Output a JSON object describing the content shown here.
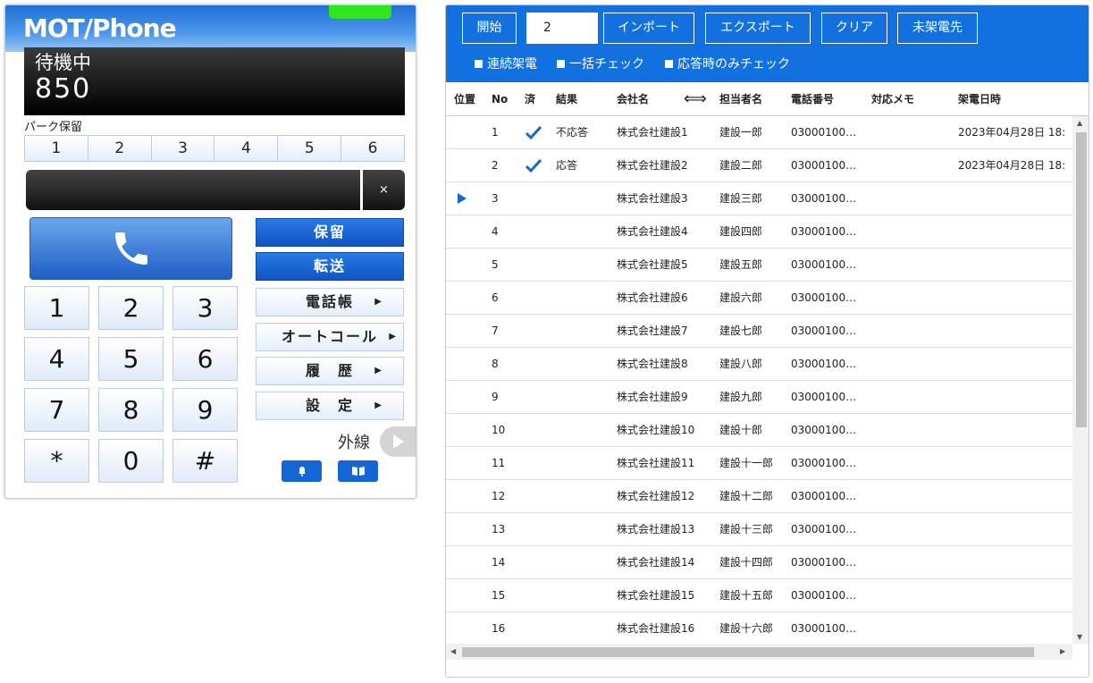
{
  "phone": {
    "logo": "MOT/Phone",
    "display": {
      "state": "待機中",
      "extension": "850"
    },
    "park": {
      "label": "パーク保留",
      "slots": [
        "1",
        "2",
        "3",
        "4",
        "5",
        "6"
      ]
    },
    "clear_label": "×",
    "keys": [
      "1",
      "2",
      "3",
      "4",
      "5",
      "6",
      "7",
      "8",
      "9",
      "*",
      "0",
      "#"
    ],
    "functions": {
      "hold": "保留",
      "transfer": "転送",
      "phonebook": "電話帳",
      "autocall": "オートコール",
      "history": "履　歴",
      "settings": "設　定",
      "arrow": "▶"
    },
    "outside_line": "外線"
  },
  "toolbar": {
    "start": "開始",
    "count_value": "2",
    "import": "インポート",
    "export": "エクスポート",
    "clear": "クリア",
    "uncalled": "未架電先",
    "options": [
      "連続架電",
      "一括チェック",
      "応答時のみチェック"
    ]
  },
  "table": {
    "headers": {
      "position": "位置",
      "no": "No",
      "done": "済",
      "result": "結果",
      "company": "会社名",
      "resize": "⟺",
      "person": "担当者名",
      "phone": "電話番号",
      "memo": "対応メモ",
      "datetime": "架電日時"
    },
    "current_row": 3,
    "rows": [
      {
        "no": "1",
        "done": true,
        "result": "不応答",
        "company": "株式会社建設1",
        "person": "建設一郎",
        "phone": "03000100…",
        "memo": "",
        "datetime": "2023年04月28日 18:"
      },
      {
        "no": "2",
        "done": true,
        "result": "応答",
        "company": "株式会社建設2",
        "person": "建設二郎",
        "phone": "03000100…",
        "memo": "",
        "datetime": "2023年04月28日 18:"
      },
      {
        "no": "3",
        "done": false,
        "result": "",
        "company": "株式会社建設3",
        "person": "建設三郎",
        "phone": "03000100…",
        "memo": "",
        "datetime": ""
      },
      {
        "no": "4",
        "done": false,
        "result": "",
        "company": "株式会社建設4",
        "person": "建設四郎",
        "phone": "03000100…",
        "memo": "",
        "datetime": ""
      },
      {
        "no": "5",
        "done": false,
        "result": "",
        "company": "株式会社建設5",
        "person": "建設五郎",
        "phone": "03000100…",
        "memo": "",
        "datetime": ""
      },
      {
        "no": "6",
        "done": false,
        "result": "",
        "company": "株式会社建設6",
        "person": "建設六郎",
        "phone": "03000100…",
        "memo": "",
        "datetime": ""
      },
      {
        "no": "7",
        "done": false,
        "result": "",
        "company": "株式会社建設7",
        "person": "建設七郎",
        "phone": "03000100…",
        "memo": "",
        "datetime": ""
      },
      {
        "no": "8",
        "done": false,
        "result": "",
        "company": "株式会社建設8",
        "person": "建設八郎",
        "phone": "03000100…",
        "memo": "",
        "datetime": ""
      },
      {
        "no": "9",
        "done": false,
        "result": "",
        "company": "株式会社建設9",
        "person": "建設九郎",
        "phone": "03000100…",
        "memo": "",
        "datetime": ""
      },
      {
        "no": "10",
        "done": false,
        "result": "",
        "company": "株式会社建設10",
        "person": "建設十郎",
        "phone": "03000100…",
        "memo": "",
        "datetime": ""
      },
      {
        "no": "11",
        "done": false,
        "result": "",
        "company": "株式会社建設11",
        "person": "建設十一郎",
        "phone": "03000100…",
        "memo": "",
        "datetime": ""
      },
      {
        "no": "12",
        "done": false,
        "result": "",
        "company": "株式会社建設12",
        "person": "建設十二郎",
        "phone": "03000100…",
        "memo": "",
        "datetime": ""
      },
      {
        "no": "13",
        "done": false,
        "result": "",
        "company": "株式会社建設13",
        "person": "建設十三郎",
        "phone": "03000100…",
        "memo": "",
        "datetime": ""
      },
      {
        "no": "14",
        "done": false,
        "result": "",
        "company": "株式会社建設14",
        "person": "建設十四郎",
        "phone": "03000100…",
        "memo": "",
        "datetime": ""
      },
      {
        "no": "15",
        "done": false,
        "result": "",
        "company": "株式会社建設15",
        "person": "建設十五郎",
        "phone": "03000100…",
        "memo": "",
        "datetime": ""
      },
      {
        "no": "16",
        "done": false,
        "result": "",
        "company": "株式会社建設16",
        "person": "建設十六郎",
        "phone": "03000100…",
        "memo": "",
        "datetime": ""
      }
    ]
  }
}
